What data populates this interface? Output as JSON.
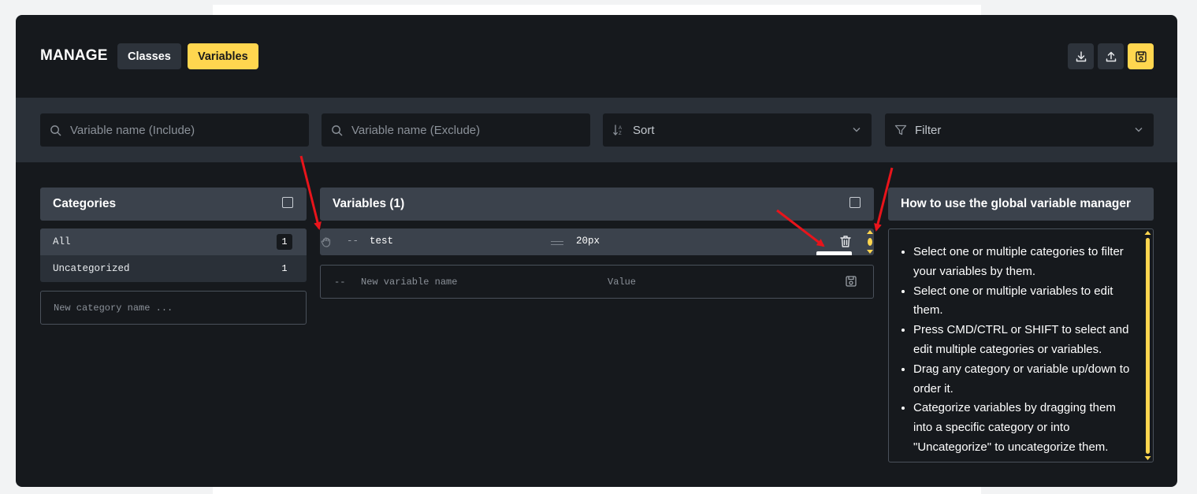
{
  "modal": {
    "title": "MANAGE",
    "tabs": [
      {
        "label": "Classes",
        "active": false
      },
      {
        "label": "Variables",
        "active": true
      }
    ],
    "header_buttons": [
      "download-icon",
      "upload-icon",
      "save-icon"
    ]
  },
  "filters": {
    "include_placeholder": "Variable name (Include)",
    "exclude_placeholder": "Variable name (Exclude)",
    "sort_label": "Sort",
    "filter_label": "Filter"
  },
  "categories": {
    "header": "Categories",
    "items": [
      {
        "name": "All",
        "count": "1",
        "selected": true
      },
      {
        "name": "Uncategorized",
        "count": "1",
        "selected": false
      }
    ],
    "new_placeholder": "New category name ..."
  },
  "variables": {
    "header": "Variables (1)",
    "items": [
      {
        "prefix": "--",
        "name": "test",
        "value": "20px"
      }
    ],
    "new_prefix": "--",
    "new_name_placeholder": "New variable name",
    "new_value_placeholder": "Value"
  },
  "howto": {
    "header": "How to use the global variable manager",
    "items": [
      "Select one or multiple categories to filter your variables by them.",
      "Select one or multiple variables to edit them.",
      "Press CMD/CTRL or SHIFT to select and edit multiple categories or variables.",
      "Drag any category or variable up/down to order it.",
      "Categorize variables by dragging them into a specific category or into \"Uncategorize\" to uncategorize them."
    ]
  },
  "colors": {
    "accent": "#ffd64f",
    "annotation_arrow": "#e8141b",
    "modal_bg": "#16191d",
    "panel_header_bg": "#3b424c"
  }
}
